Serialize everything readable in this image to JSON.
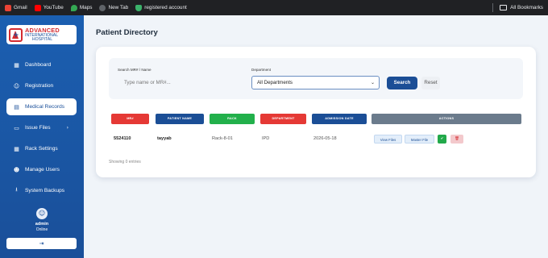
{
  "bookmarks": {
    "items": [
      {
        "label": "Gmail",
        "color": "#ea4335"
      },
      {
        "label": "YouTube",
        "color": "#ff0000"
      },
      {
        "label": "Maps",
        "color": "#34a853"
      },
      {
        "label": "New Tab",
        "color": "#5f6368"
      },
      {
        "label": "registered account",
        "color": "#3bb36b"
      }
    ],
    "all_bookmarks": "All Bookmarks"
  },
  "logo": {
    "line1": "ADVANCED",
    "line2": "INTERNATIONAL",
    "line3": "HOSPITAL"
  },
  "sidebar": {
    "items": [
      {
        "label": "Dashboard",
        "icon": "dashboard-icon",
        "glyph": "▦",
        "active": false
      },
      {
        "label": "Registration",
        "icon": "user-icon",
        "glyph": "☺",
        "active": false
      },
      {
        "label": "Medical Records",
        "icon": "document-icon",
        "glyph": "▤",
        "active": true
      },
      {
        "label": "Issue Files",
        "icon": "files-icon",
        "glyph": "▭",
        "active": false,
        "chevron": "›"
      },
      {
        "label": "Rack Settings",
        "icon": "rack-icon",
        "glyph": "▦",
        "active": false
      },
      {
        "label": "Manage Users",
        "icon": "users-icon",
        "glyph": "☻",
        "active": false
      },
      {
        "label": "System Backups",
        "icon": "download-icon",
        "glyph": "⭳",
        "active": false
      }
    ],
    "user": {
      "name": "admin",
      "status": "Online"
    },
    "logout_glyph": "⇥"
  },
  "main": {
    "title": "Patient Directory",
    "filters": {
      "search_label": "Search MR# / Name",
      "search_placeholder": "Type name or MR#...",
      "department_label": "Department",
      "department_value": "All Departments",
      "search_button": "Search",
      "reset_button": "Reset"
    },
    "table": {
      "headers": [
        {
          "label": "MR#",
          "color": "#e53935"
        },
        {
          "label": "PATIENT NAME",
          "color": "#1b4e96"
        },
        {
          "label": "RACK",
          "color": "#22b04b"
        },
        {
          "label": "DEPARTMENT",
          "color": "#e53935"
        },
        {
          "label": "ADMISSION DATE",
          "color": "#1b4e96"
        },
        {
          "label": "ACTIONS",
          "color": "#6b7b8c"
        }
      ],
      "rows": [
        {
          "mr": "5524110",
          "name": "tayyab",
          "rack": "Rack-8-01",
          "department": "IPD",
          "admission_date": "2026-05-18",
          "actions": {
            "view": "View Files",
            "master": "Master File"
          }
        }
      ],
      "showing": "Showing 0 entries"
    }
  }
}
